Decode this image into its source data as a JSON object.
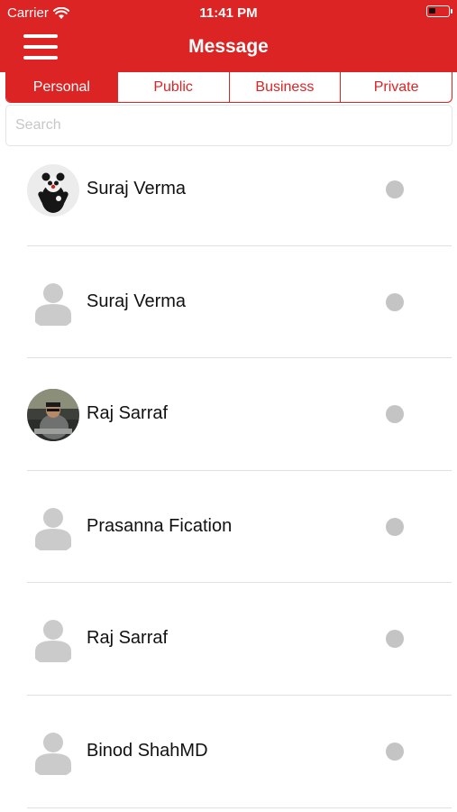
{
  "status_bar": {
    "carrier": "Carrier",
    "time": "11:41 PM",
    "battery_level": 0.35
  },
  "header": {
    "title": "Message",
    "menu_icon": "hamburger-menu-icon"
  },
  "tabs": [
    {
      "label": "Personal",
      "active": true
    },
    {
      "label": "Public",
      "active": false
    },
    {
      "label": "Business",
      "active": false
    },
    {
      "label": "Private",
      "active": false
    }
  ],
  "search": {
    "placeholder": "Search",
    "value": ""
  },
  "contacts": [
    {
      "name": "Suraj Verma",
      "avatar": "panda-photo-avatar",
      "status": "offline"
    },
    {
      "name": "Suraj Verma",
      "avatar": "default-person-avatar",
      "status": "offline"
    },
    {
      "name": "Raj Sarraf",
      "avatar": "person-photo-avatar",
      "status": "offline"
    },
    {
      "name": "Prasanna Fication",
      "avatar": "default-person-avatar",
      "status": "offline"
    },
    {
      "name": "Raj Sarraf",
      "avatar": "default-person-avatar",
      "status": "offline"
    },
    {
      "name": "Binod ShahMD",
      "avatar": "default-person-avatar",
      "status": "offline"
    }
  ],
  "colors": {
    "accent": "#dc2424",
    "status_offline": "#c4c4c4",
    "divider": "#e0e0e0"
  }
}
